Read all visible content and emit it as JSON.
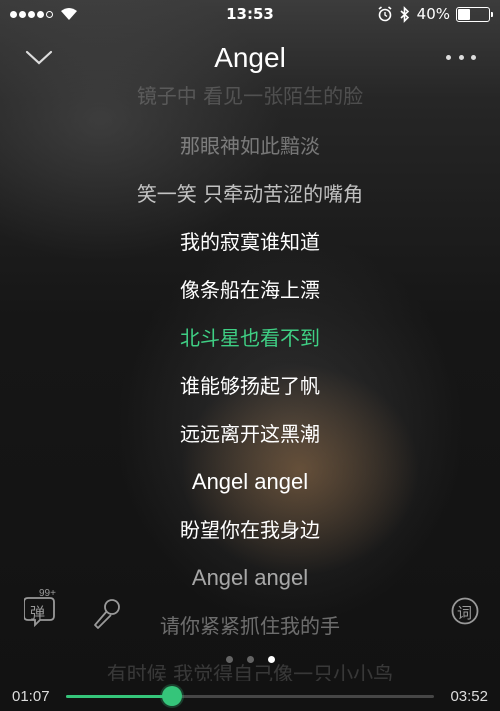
{
  "status_bar": {
    "time": "13:53",
    "battery_text": "40%",
    "battery_level": 0.4,
    "signal_bars": 4,
    "signal_total": 5
  },
  "header": {
    "title": "Angel",
    "back_icon": "chevron-down-icon",
    "more_icon": "more-dots-icon"
  },
  "lyrics": {
    "active_index": 5,
    "active_color": "#3fcf84",
    "lines": [
      {
        "text": "镜子中 看见一张陌生的脸",
        "opacity": 0.18
      },
      {
        "text": "那眼神如此黯淡",
        "opacity": 0.38
      },
      {
        "text": "笑一笑 只牵动苦涩的嘴角",
        "opacity": 0.72
      },
      {
        "text": "我的寂寞谁知道",
        "opacity": 1
      },
      {
        "text": "像条船在海上漂",
        "opacity": 1
      },
      {
        "text": "北斗星也看不到",
        "opacity": 1
      },
      {
        "text": "谁能够扬起了帆",
        "opacity": 1
      },
      {
        "text": "远远离开这黑潮",
        "opacity": 1
      },
      {
        "text": "Angel angel",
        "opacity": 1
      },
      {
        "text": "盼望你在我身边",
        "opacity": 1
      },
      {
        "text": "Angel angel",
        "opacity": 0.62
      },
      {
        "text": "请你紧紧抓住我的手",
        "opacity": 0.38
      },
      {
        "text": "有时候 我觉得自己像一只小小鸟",
        "opacity": 0.16
      }
    ]
  },
  "controls": {
    "danmu_label": "弹",
    "danmu_badge": "99+",
    "mic_icon": "microphone-icon",
    "lyrics_toggle_label": "词"
  },
  "pager": {
    "count": 3,
    "active": 2
  },
  "playback": {
    "current_time": "01:07",
    "total_time": "03:52",
    "progress": 0.2886,
    "accent": "#35c57a"
  }
}
